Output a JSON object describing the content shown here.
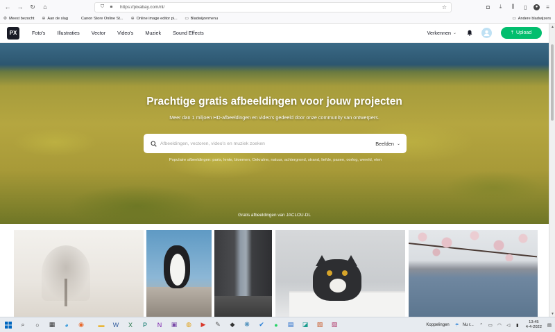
{
  "browser": {
    "url": "https://pixabay.com/nl/",
    "bookmarks": [
      {
        "label": "Meest bezocht",
        "icon": "gear-icon"
      },
      {
        "label": "Aan de slag",
        "icon": "globe-icon"
      },
      {
        "label": "Canon Store Online St...",
        "icon": "bookmark-icon"
      },
      {
        "label": "Online image editor pi...",
        "icon": "globe-icon"
      },
      {
        "label": "Bladwijzermenu",
        "icon": "folder-icon"
      }
    ],
    "other_bookmarks": "Andere bladwijzers"
  },
  "site": {
    "logo": "PX",
    "nav": [
      "Foto's",
      "Illustraties",
      "Vector",
      "Video's",
      "Muziek",
      "Sound Effects"
    ],
    "explore": "Verkennen",
    "upload": "Upload"
  },
  "hero": {
    "title": "Prachtige gratis afbeeldingen voor jouw projecten",
    "subtitle": "Meer dan 1 miljoen HD-afbeeldingen en video's gedeeld door onze community van ontwerpers.",
    "search_placeholder": "Afbeeldingen, vectoren, video's en muziek zoeken",
    "search_type": "Beelden",
    "popular": "Populaire afbeeldingen: paris, lente, bloemen, Oekraïne, natuur, achtergrond, strand, liefde, pasen, oorlog, wereld, eten",
    "credit": "Gratis afbeeldingen van JACLOU-DL"
  },
  "gallery": [
    {
      "name": "photo-foggy-tree"
    },
    {
      "name": "photo-penguin"
    },
    {
      "name": "photo-alley"
    },
    {
      "name": "photo-cat"
    },
    {
      "name": "photo-cherry-blossom"
    }
  ],
  "taskbar": {
    "links_label": "Koppelingen",
    "weather": "Nu r...",
    "time": "13:45",
    "date": "4-4-2022"
  },
  "colors": {
    "upload_green": "#02be6e",
    "logo_dark": "#191b26"
  }
}
